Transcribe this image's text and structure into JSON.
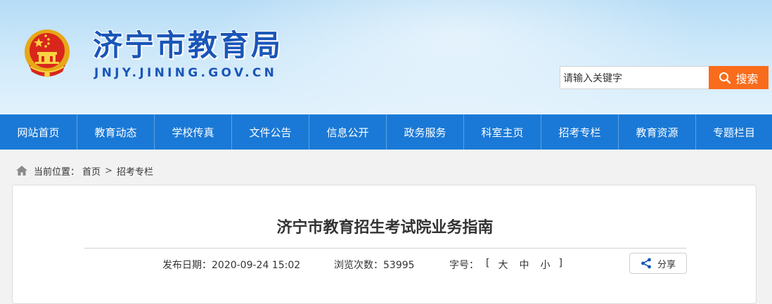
{
  "header": {
    "site_title": "济宁市教育局",
    "site_domain": "JNJY.JINING.GOV.CN"
  },
  "search": {
    "placeholder": "请输入关键字",
    "button_label": "搜索"
  },
  "nav": {
    "items": [
      "网站首页",
      "教育动态",
      "学校传真",
      "文件公告",
      "信息公开",
      "政务服务",
      "科室主页",
      "招考专栏",
      "教育资源",
      "专题栏目"
    ]
  },
  "breadcrumb": {
    "prefix": "当前位置：",
    "home": "首页",
    "separator": ">",
    "current": "招考专栏"
  },
  "article": {
    "title": "济宁市教育招生考试院业务指南",
    "date_label": "发布日期：",
    "date_value": "2020-09-24 15:02",
    "views_label": "浏览次数：",
    "views_value": "53995",
    "font_label": "字号：",
    "bracket_open": "[",
    "font_large": "大",
    "font_medium": "中",
    "font_small": "小",
    "bracket_close": "]",
    "share_label": "分享"
  },
  "colors": {
    "brand_blue": "#1a56b8",
    "nav_blue": "#1a79d6",
    "search_orange": "#f96c1b"
  },
  "icons": [
    "national-emblem-icon",
    "search-icon",
    "home-icon",
    "share-icon"
  ]
}
